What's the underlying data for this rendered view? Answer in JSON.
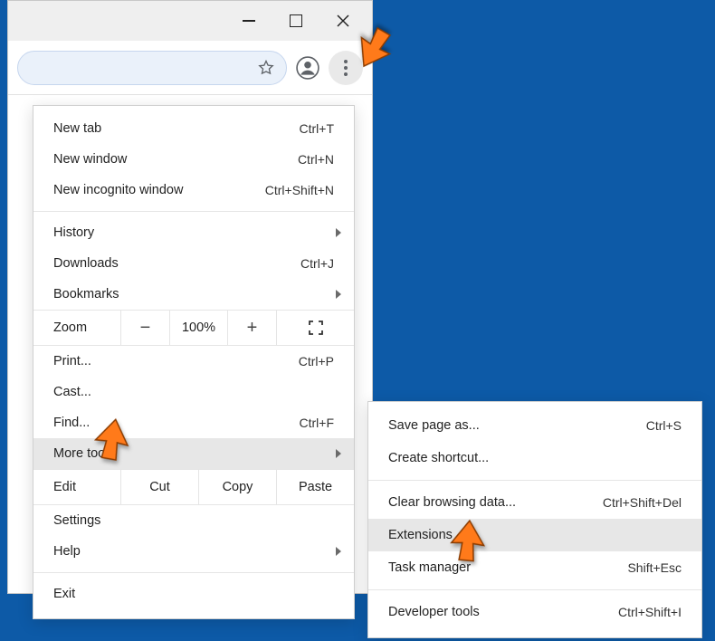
{
  "window": {
    "min": "minimize",
    "max": "maximize",
    "close": "close"
  },
  "toolbar": {
    "bookmark": "bookmark-star",
    "profile": "profile",
    "menu": "menu"
  },
  "mainMenu": {
    "newTab": {
      "label": "New tab",
      "shortcut": "Ctrl+T"
    },
    "newWindow": {
      "label": "New window",
      "shortcut": "Ctrl+N"
    },
    "newIncognito": {
      "label": "New incognito window",
      "shortcut": "Ctrl+Shift+N"
    },
    "history": {
      "label": "History"
    },
    "downloads": {
      "label": "Downloads",
      "shortcut": "Ctrl+J"
    },
    "bookmarks": {
      "label": "Bookmarks"
    },
    "zoom": {
      "label": "Zoom",
      "minus": "−",
      "value": "100%",
      "plus": "+"
    },
    "print": {
      "label": "Print...",
      "shortcut": "Ctrl+P"
    },
    "cast": {
      "label": "Cast..."
    },
    "find": {
      "label": "Find...",
      "shortcut": "Ctrl+F"
    },
    "moreTools": {
      "label": "More tools"
    },
    "edit": {
      "label": "Edit",
      "cut": "Cut",
      "copy": "Copy",
      "paste": "Paste"
    },
    "settings": {
      "label": "Settings"
    },
    "help": {
      "label": "Help"
    },
    "exit": {
      "label": "Exit"
    }
  },
  "subMenu": {
    "savePage": {
      "label": "Save page as...",
      "shortcut": "Ctrl+S"
    },
    "createShortcut": {
      "label": "Create shortcut..."
    },
    "clearData": {
      "label": "Clear browsing data...",
      "shortcut": "Ctrl+Shift+Del"
    },
    "extensions": {
      "label": "Extensions"
    },
    "taskManager": {
      "label": "Task manager",
      "shortcut": "Shift+Esc"
    },
    "devTools": {
      "label": "Developer tools",
      "shortcut": "Ctrl+Shift+I"
    }
  }
}
